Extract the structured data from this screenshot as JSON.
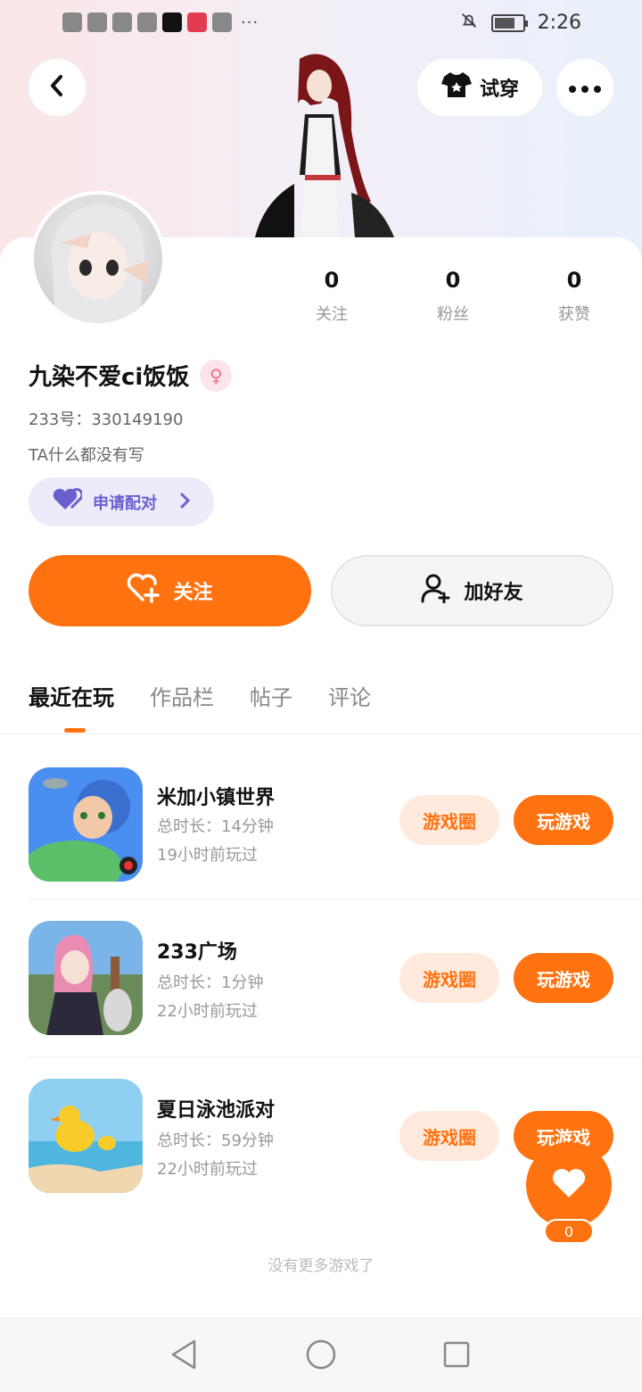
{
  "status_bar": {
    "time": "2:26"
  },
  "header": {
    "back_icon": "chevron-left-icon",
    "try_on_label": "试穿",
    "more_icon": "more-dots-icon"
  },
  "profile": {
    "stats": [
      {
        "value": "0",
        "label": "关注"
      },
      {
        "value": "0",
        "label": "粉丝"
      },
      {
        "value": "0",
        "label": "获赞"
      }
    ],
    "nickname": "九染不爱ci饭饭",
    "gender_symbol": "♀",
    "uid_text": "233号：330149190",
    "bio": "TA什么都没有写",
    "pair_label": "申请配对"
  },
  "actions": {
    "follow_label": "关注",
    "add_friend_label": "加好友"
  },
  "tabs": [
    {
      "label": "最近在玩",
      "active": true
    },
    {
      "label": "作品栏",
      "active": false
    },
    {
      "label": "帖子",
      "active": false
    },
    {
      "label": "评论",
      "active": false
    }
  ],
  "games": [
    {
      "name": "米加小镇世界",
      "duration": "总时长：14分钟",
      "last_played": "19小时前玩过",
      "circle_label": "游戏圈",
      "play_label": "玩游戏"
    },
    {
      "name": "233广场",
      "duration": "总时长：1分钟",
      "last_played": "22小时前玩过",
      "circle_label": "游戏圈",
      "play_label": "玩游戏"
    },
    {
      "name": "夏日泳池派对",
      "duration": "总时长：59分钟",
      "last_played": "22小时前玩过",
      "circle_label": "游戏圈",
      "play_label": "玩游戏"
    }
  ],
  "no_more_text": "没有更多游戏了",
  "like_fab": {
    "count": "0"
  },
  "colors": {
    "accent": "#ff7210",
    "accent_light": "#ffeadd",
    "pair_bg": "#ecebfa",
    "pair_text": "#6b5fcf",
    "gender_pink": "#f06e8a"
  }
}
